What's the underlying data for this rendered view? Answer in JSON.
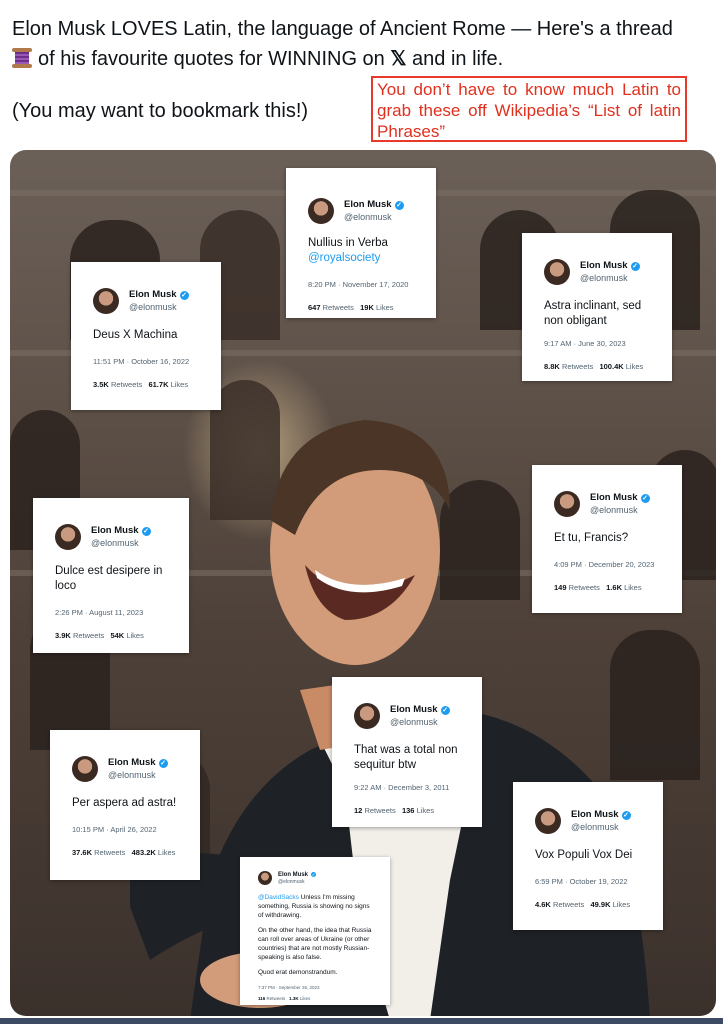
{
  "post": {
    "line1": "Elon Musk LOVES Latin, the language of Ancient Rome — Here's a thread",
    "line2_pre": "of his favourite quotes for WINNING on ",
    "x_logo": "𝕏",
    "line2_post": " and in life.",
    "line3": "(You may want to bookmark this!)",
    "spool_icon": "spool-of-thread-emoji"
  },
  "annotation": {
    "text": "You don’t have to know much Latin to grab these off Wikipedia’s “List of latin Phrases”",
    "color": "#e0301e"
  },
  "tweets": [
    {
      "name": "Elon Musk",
      "handle": "@elonmusk",
      "text": "Nullius in Verba",
      "mention": "@royalsociety",
      "time": "8:20 PM · November 17, 2020",
      "retweets": "647",
      "retweets_label": "Retweets",
      "likes": "19K",
      "likes_label": "Likes"
    },
    {
      "name": "Elon Musk",
      "handle": "@elonmusk",
      "text": "Deus X Machina",
      "time": "11:51 PM · October 16, 2022",
      "retweets": "3.5K",
      "retweets_label": "Retweets",
      "likes": "61.7K",
      "likes_label": "Likes"
    },
    {
      "name": "Elon Musk",
      "handle": "@elonmusk",
      "text": "Astra inclinant, sed non obligant",
      "time": "9:17 AM · June 30, 2023",
      "retweets": "8.8K",
      "retweets_label": "Retweets",
      "likes": "100.4K",
      "likes_label": "Likes"
    },
    {
      "name": "Elon Musk",
      "handle": "@elonmusk",
      "text": "Dulce est desipere in loco",
      "time": "2:26 PM · August 11, 2023",
      "retweets": "3.9K",
      "retweets_label": "Retweets",
      "likes": "54K",
      "likes_label": "Likes"
    },
    {
      "name": "Elon Musk",
      "handle": "@elonmusk",
      "text": "Et tu, Francis?",
      "time": "4:09 PM · December 20, 2023",
      "retweets": "149",
      "retweets_label": "Retweets",
      "likes": "1.6K",
      "likes_label": "Likes"
    },
    {
      "name": "Elon Musk",
      "handle": "@elonmusk",
      "text": "That was a total non sequitur btw",
      "time": "9:22 AM · December 3, 2011",
      "retweets": "12",
      "retweets_label": "Retweets",
      "likes": "136",
      "likes_label": "Likes"
    },
    {
      "name": "Elon Musk",
      "handle": "@elonmusk",
      "text": "Per aspera ad astra!",
      "time": "10:15 PM · April 26, 2022",
      "retweets": "37.6K",
      "retweets_label": "Retweets",
      "likes": "483.2K",
      "likes_label": "Likes"
    },
    {
      "name": "Elon Musk",
      "handle": "@elonmusk",
      "text": "Vox Populi Vox Dei",
      "time": "6:59 PM · October 19, 2022",
      "retweets": "4.6K",
      "retweets_label": "Retweets",
      "likes": "49.9K",
      "likes_label": "Likes"
    },
    {
      "name": "Elon Musk",
      "handle": "@elonmusk",
      "mention": "@DavidSacks",
      "text": "Unless I'm missing something, Russia is showing no signs of withdrawing.",
      "text2": "On the other hand, the idea that Russia can roll over areas of Ukraine (or other countries) that are not mostly Russian-speaking is also false.",
      "text3": "Quod erat demonstrandum.",
      "time": "7:37 PM · September 26, 2023",
      "retweets": "116",
      "retweets_label": "Retweets",
      "likes": "1.3K",
      "likes_label": "Likes"
    }
  ],
  "colors": {
    "link": "#1d9bf0",
    "verified": "#1d9bf0",
    "text": "#0f1419",
    "muted": "#536471"
  }
}
